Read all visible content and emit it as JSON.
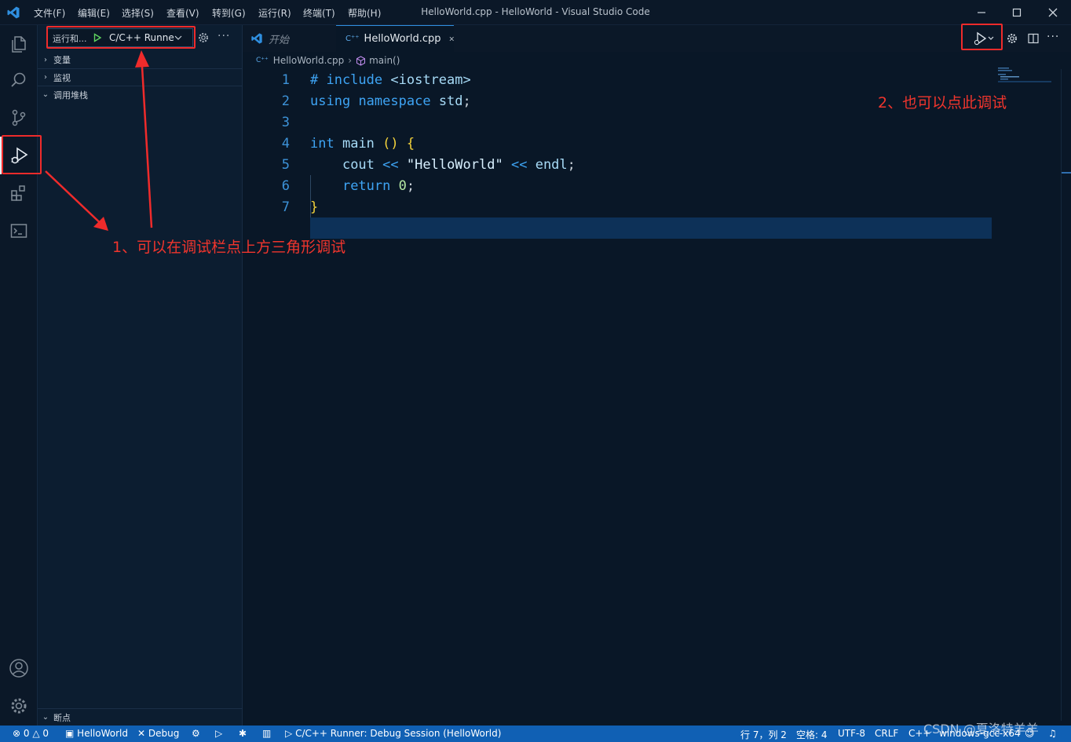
{
  "titlebar": {
    "menus": [
      "文件(F)",
      "编辑(E)",
      "选择(S)",
      "查看(V)",
      "转到(G)",
      "运行(R)",
      "终端(T)",
      "帮助(H)"
    ],
    "title": "HelloWorld.cpp - HelloWorld - Visual Studio Code"
  },
  "sidebar": {
    "run_label": "运行和...",
    "config_name": "C/C++ Runne",
    "sections": [
      "变量",
      "监视",
      "调用堆栈"
    ],
    "breakpoints": "断点"
  },
  "tabs": [
    {
      "label": "开始",
      "active": false
    },
    {
      "label": "HelloWorld.cpp",
      "active": true
    }
  ],
  "breadcrumb": {
    "file": "HelloWorld.cpp",
    "symbol": "main()"
  },
  "code": {
    "line_numbers": [
      "1",
      "2",
      "3",
      "4",
      "5",
      "6",
      "7"
    ],
    "highlight_line": 7
  },
  "annotations": {
    "note1": "1、可以在调试栏点上方三角形调试",
    "note2": "2、也可以点此调试"
  },
  "statusbar": {
    "errors": "0",
    "warnings": "0",
    "folder": "HelloWorld",
    "debug": "Debug",
    "session": "C/C++ Runner: Debug Session (HelloWorld)",
    "position": "行 7，列 2",
    "spaces": "空格: 4",
    "encoding": "UTF-8",
    "eol": "CRLF",
    "language": "C++",
    "compiler": "windows-gcc-x64"
  },
  "watermark": "CSDN @夏洛特羊羊",
  "colors": {
    "accent": "#1060b4",
    "annotation": "#ef2b2b",
    "background": "#091727"
  }
}
